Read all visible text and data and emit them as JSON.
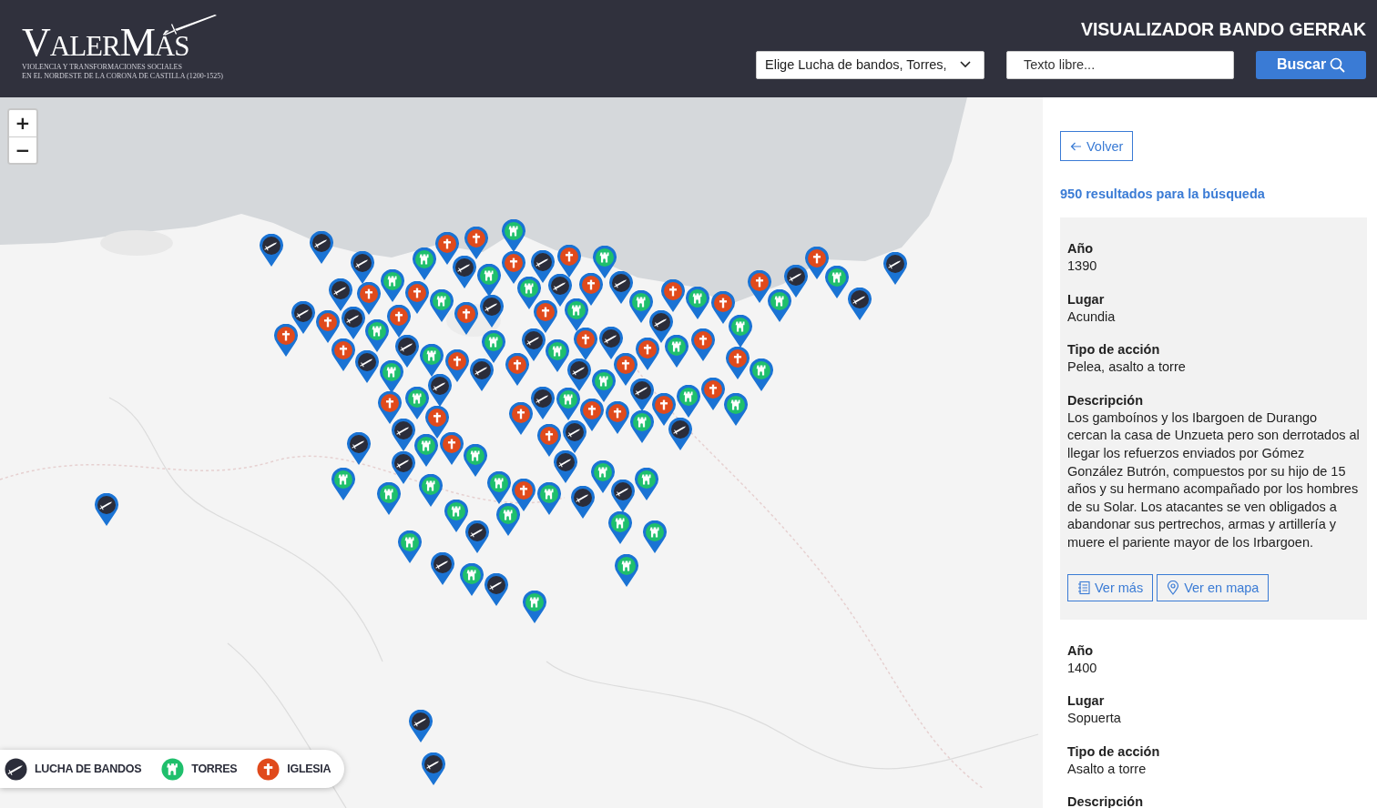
{
  "header": {
    "logo": {
      "title": "ValerMás",
      "subtitle_lines": [
        "VIOLENCIA Y TRANSFORMACIONES SOCIALES",
        "EN EL NORDESTE DE LA CORONA DE CASTILLA (1200-1525)"
      ]
    },
    "title": "VISUALIZADOR BANDO GERRAK",
    "filter_select": {
      "value": "Elige Lucha de bandos, Torres,"
    },
    "search_field": {
      "placeholder": "Texto libre..."
    },
    "search_button": {
      "label": "Buscar"
    }
  },
  "map": {
    "kind": "picture",
    "zoom_controls": [
      "+",
      "−"
    ],
    "legend": [
      {
        "kind": "lucha",
        "label": "LUCHA DE BANDOS"
      },
      {
        "kind": "torre",
        "label": "TORRES"
      },
      {
        "kind": "iglesia",
        "label": "IGLESIA"
      }
    ],
    "markers": [
      {
        "kind": "lucha"
      },
      {
        "kind": "lucha"
      },
      {
        "kind": "lucha"
      },
      {
        "kind": "torre"
      },
      {
        "kind": "iglesia"
      },
      {
        "kind": "iglesia"
      },
      {
        "kind": "lucha"
      },
      {
        "kind": "torre"
      },
      {
        "kind": "torre"
      },
      {
        "kind": "torre"
      },
      {
        "kind": "iglesia"
      },
      {
        "kind": "lucha"
      },
      {
        "kind": "iglesia"
      },
      {
        "kind": "torre"
      },
      {
        "kind": "iglesia"
      },
      {
        "kind": "lucha"
      },
      {
        "kind": "torre"
      },
      {
        "kind": "iglesia"
      },
      {
        "kind": "lucha"
      },
      {
        "kind": "torre"
      },
      {
        "kind": "iglesia"
      },
      {
        "kind": "torre"
      },
      {
        "kind": "iglesia"
      },
      {
        "kind": "torre"
      },
      {
        "kind": "iglesia"
      },
      {
        "kind": "iglesia"
      },
      {
        "kind": "lucha"
      },
      {
        "kind": "torre"
      },
      {
        "kind": "iglesia"
      },
      {
        "kind": "torre"
      },
      {
        "kind": "lucha"
      },
      {
        "kind": "lucha"
      },
      {
        "kind": "iglesia"
      },
      {
        "kind": "torre"
      },
      {
        "kind": "iglesia"
      },
      {
        "kind": "lucha"
      },
      {
        "kind": "iglesia"
      },
      {
        "kind": "torre"
      },
      {
        "kind": "lucha"
      },
      {
        "kind": "iglesia"
      },
      {
        "kind": "lucha"
      },
      {
        "kind": "iglesia"
      },
      {
        "kind": "lucha"
      },
      {
        "kind": "torre"
      },
      {
        "kind": "iglesia"
      },
      {
        "kind": "lucha"
      },
      {
        "kind": "iglesia"
      },
      {
        "kind": "lucha"
      },
      {
        "kind": "torre"
      },
      {
        "kind": "iglesia"
      },
      {
        "kind": "torre"
      },
      {
        "kind": "lucha"
      },
      {
        "kind": "iglesia"
      },
      {
        "kind": "lucha"
      },
      {
        "kind": "torre"
      },
      {
        "kind": "lucha"
      },
      {
        "kind": "iglesia"
      },
      {
        "kind": "torre"
      },
      {
        "kind": "iglesia"
      },
      {
        "kind": "lucha"
      },
      {
        "kind": "iglesia"
      },
      {
        "kind": "torre"
      },
      {
        "kind": "lucha"
      },
      {
        "kind": "iglesia"
      },
      {
        "kind": "torre"
      },
      {
        "kind": "lucha"
      },
      {
        "kind": "torre"
      },
      {
        "kind": "iglesia"
      },
      {
        "kind": "lucha"
      },
      {
        "kind": "torre"
      },
      {
        "kind": "iglesia"
      },
      {
        "kind": "lucha"
      },
      {
        "kind": "torre"
      },
      {
        "kind": "iglesia"
      },
      {
        "kind": "torre"
      },
      {
        "kind": "iglesia"
      },
      {
        "kind": "lucha"
      },
      {
        "kind": "torre"
      },
      {
        "kind": "iglesia"
      },
      {
        "kind": "iglesia"
      },
      {
        "kind": "iglesia"
      },
      {
        "kind": "lucha"
      },
      {
        "kind": "torre"
      },
      {
        "kind": "iglesia"
      },
      {
        "kind": "lucha"
      },
      {
        "kind": "torre"
      },
      {
        "kind": "iglesia"
      },
      {
        "kind": "torre"
      },
      {
        "kind": "lucha"
      },
      {
        "kind": "lucha"
      },
      {
        "kind": "torre"
      },
      {
        "kind": "torre"
      },
      {
        "kind": "torre"
      },
      {
        "kind": "torre"
      },
      {
        "kind": "iglesia"
      },
      {
        "kind": "torre"
      },
      {
        "kind": "lucha"
      },
      {
        "kind": "lucha"
      },
      {
        "kind": "torre"
      },
      {
        "kind": "torre"
      },
      {
        "kind": "lucha"
      },
      {
        "kind": "torre"
      },
      {
        "kind": "torre"
      },
      {
        "kind": "lucha"
      },
      {
        "kind": "torre"
      },
      {
        "kind": "torre"
      },
      {
        "kind": "torre"
      },
      {
        "kind": "lucha"
      },
      {
        "kind": "lucha"
      },
      {
        "kind": "torre"
      },
      {
        "kind": "lucha"
      },
      {
        "kind": "torre"
      },
      {
        "kind": "torre"
      },
      {
        "kind": "lucha"
      },
      {
        "kind": "lucha"
      }
    ]
  },
  "sidebar": {
    "back_button": {
      "label": "Volver"
    },
    "results_count": "950 resultados para la búsqueda",
    "results": [
      {
        "selected": true,
        "fields": [
          {
            "label": "Año",
            "value": "1390"
          },
          {
            "label": "Lugar",
            "value": "Acundia"
          },
          {
            "label": "Tipo de acción",
            "value": "Pelea, asalto a torre"
          },
          {
            "label": "Descripción",
            "value": "Los gamboínos y los Ibargoen de Durango cercan la casa de Unzueta pero son derrotados al llegar los refuerzos enviados por Gómez González Butrón, compuestos por su hijo de 15 años y su hermano acompañado por los hombres de su Solar. Los atacantes se ven obligados a abandonar sus pertrechos, armas y artillería y muere el pariente mayor de los Irbargoen."
          }
        ],
        "buttons": [
          {
            "kind": "details",
            "label": "Ver más"
          },
          {
            "kind": "map",
            "label": "Ver en mapa"
          }
        ]
      },
      {
        "selected": false,
        "fields": [
          {
            "label": "Año",
            "value": "1400"
          },
          {
            "label": "Lugar",
            "value": "Sopuerta"
          },
          {
            "label": "Tipo de acción",
            "value": "Asalto a torre"
          },
          {
            "label": "Descripción"
          }
        ]
      }
    ]
  }
}
